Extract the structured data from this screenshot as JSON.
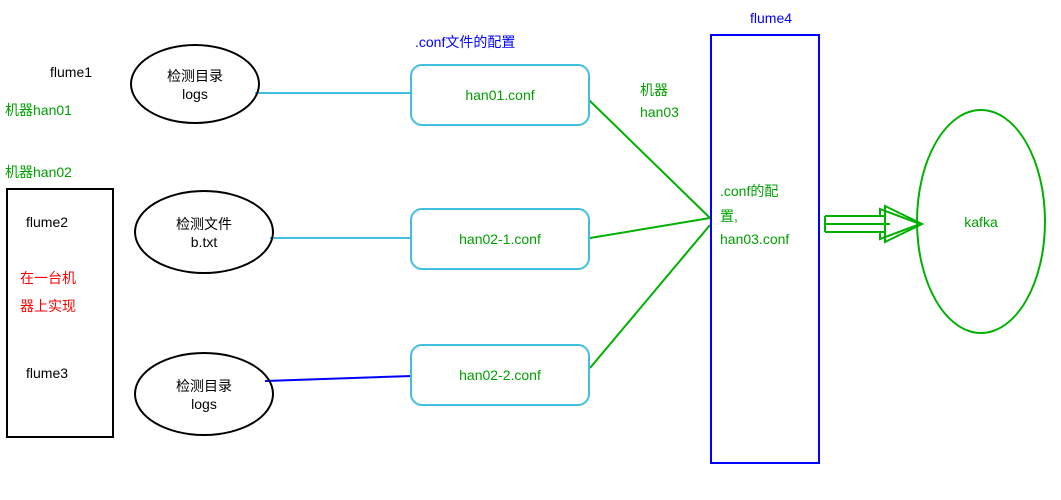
{
  "labels": {
    "flume1": "flume1",
    "flume2": "flume2",
    "flume3": "flume3",
    "flume4": "flume4",
    "machine_han01": "机器han01",
    "machine_han02": "机器han02",
    "machine_han03_line1": "机器",
    "machine_han03_line2": "han03",
    "conf_title": ".conf文件的配置",
    "on_one_machine_line1": "在一台机",
    "on_one_machine_line2": "器上实现",
    "kafka": "kafka"
  },
  "ellipses": {
    "logs1_line1": "检测目录",
    "logs1_line2": "logs",
    "btxt_line1": "检测文件",
    "btxt_line2": "b.txt",
    "logs2_line1": "检测目录",
    "logs2_line2": "logs"
  },
  "conf_boxes": {
    "han01": "han01.conf",
    "han02_1": "han02-1.conf",
    "han02_2": "han02-2.conf"
  },
  "flume4_box": {
    "line1": ".conf的配",
    "line2": "置,",
    "line3": "han03.conf"
  },
  "chart_data": {
    "type": "table",
    "nodes": [
      {
        "id": "flume1",
        "host": "han01",
        "source": "检测目录 logs",
        "conf": "han01.conf"
      },
      {
        "id": "flume2",
        "host": "han02",
        "source": "检测文件 b.txt",
        "conf": "han02-1.conf"
      },
      {
        "id": "flume3",
        "host": "han02",
        "source": "检测目录 logs",
        "conf": "han02-2.conf"
      },
      {
        "id": "flume4",
        "host": "han03",
        "conf": "han03.conf",
        "output": "kafka"
      }
    ],
    "edges": [
      {
        "from": "flume1.logs",
        "to": "han01.conf"
      },
      {
        "from": "flume2.btxt",
        "to": "han02-1.conf"
      },
      {
        "from": "flume3.logs",
        "to": "han02-2.conf"
      },
      {
        "from": "han01.conf",
        "to": "flume4"
      },
      {
        "from": "han02-1.conf",
        "to": "flume4"
      },
      {
        "from": "han02-2.conf",
        "to": "flume4"
      },
      {
        "from": "flume4",
        "to": "kafka"
      }
    ]
  }
}
